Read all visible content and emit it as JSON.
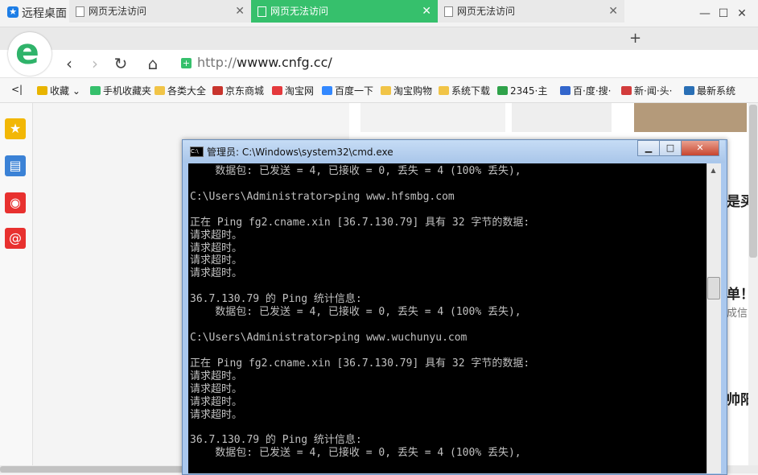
{
  "window": {
    "title": "远程桌面",
    "controls": {
      "minimize": "—",
      "maximize": "☐",
      "close": "✕"
    }
  },
  "tabs": [
    {
      "label": "网页无法访问",
      "close": "✕"
    },
    {
      "label": "网页无法访问",
      "close": "✕"
    },
    {
      "label": "网页无法访问",
      "close": "✕"
    }
  ],
  "new_tab": "+",
  "browser_logo": "e",
  "nav": {
    "back": "‹",
    "forward": "›",
    "refresh": "↻",
    "home": "⌂",
    "url_prefix": "http://",
    "url_host": "wwww.cnfg.cc/"
  },
  "bookmarks": {
    "toggle": "<|",
    "items": [
      {
        "label": "收藏 ⌄",
        "color": "#e8b400"
      },
      {
        "label": "手机收藏夹",
        "color": "#36c06c"
      },
      {
        "label": "各类大全",
        "color": "#f1c447"
      },
      {
        "label": "京东商城",
        "color": "#c8342d"
      },
      {
        "label": "淘宝网",
        "color": "#e4393c"
      },
      {
        "label": "百度一下",
        "color": "#3388ff"
      },
      {
        "label": "淘宝购物",
        "color": "#f1c447"
      },
      {
        "label": "系统下载",
        "color": "#f1c447"
      },
      {
        "label": "2345·主",
        "color": "#2fa24a"
      },
      {
        "label": "百·度·搜·",
        "color": "#3366cc"
      },
      {
        "label": "新·闻·头·",
        "color": "#d23c3c"
      },
      {
        "label": "最新系统",
        "color": "#2a6fb5"
      }
    ]
  },
  "sidebar": [
    {
      "icon": "star-icon",
      "glyph": "★",
      "color": "#f2b705"
    },
    {
      "icon": "note-icon",
      "glyph": "▤",
      "color": "#3b82d6"
    },
    {
      "icon": "weibo-icon",
      "glyph": "◉",
      "color": "#e8312f"
    },
    {
      "icon": "mail-icon",
      "glyph": "@",
      "color": "#e8312f"
    }
  ],
  "page_fragments": {
    "text1": "是买",
    "text2": "单！",
    "text3": "成信",
    "text4": "帅阳"
  },
  "cmd": {
    "title": "管理员: C:\\Windows\\system32\\cmd.exe",
    "icon_text": "C:\\",
    "controls": {
      "minimize": "▁",
      "maximize": "□",
      "close": "✕"
    },
    "console_text": "    数据包: 已发送 = 4, 已接收 = 0, 丢失 = 4 (100% 丢失),\n\nC:\\Users\\Administrator>ping www.hfsmbg.com\n\n正在 Ping fg2.cname.xin [36.7.130.79] 具有 32 字节的数据:\n请求超时。\n请求超时。\n请求超时。\n请求超时。\n\n36.7.130.79 的 Ping 统计信息:\n    数据包: 已发送 = 4, 已接收 = 0, 丢失 = 4 (100% 丢失),\n\nC:\\Users\\Administrator>ping www.wuchunyu.com\n\n正在 Ping fg2.cname.xin [36.7.130.79] 具有 32 字节的数据:\n请求超时。\n请求超时。\n请求超时。\n请求超时。\n\n36.7.130.79 的 Ping 统计信息:\n    数据包: 已发送 = 4, 已接收 = 0, 丢失 = 4 (100% 丢失),",
    "scroll_up": "▲"
  }
}
